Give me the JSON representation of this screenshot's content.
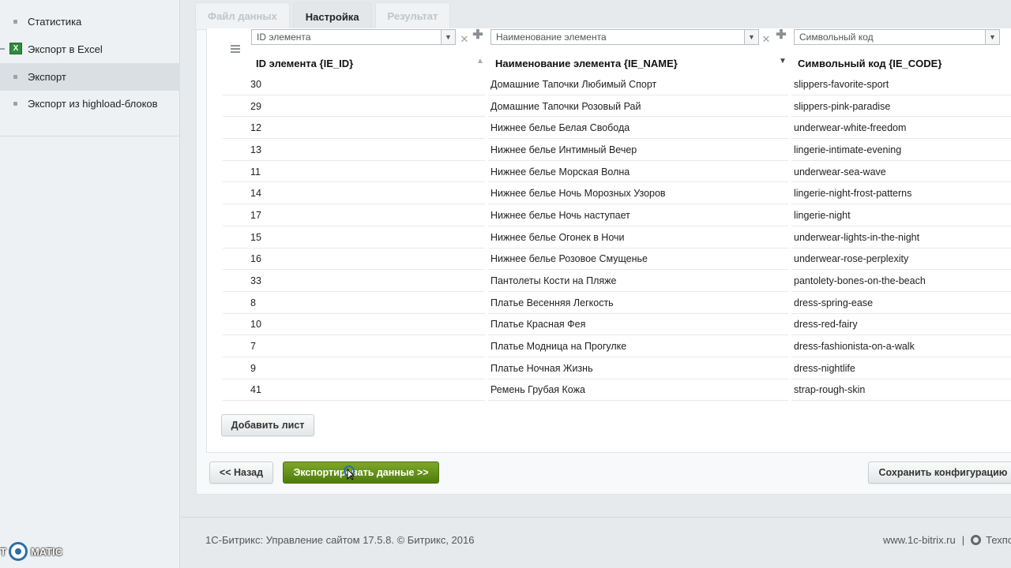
{
  "sidebar": {
    "items": [
      {
        "label": "Статистика",
        "icon": "bullet-icon",
        "active": false
      },
      {
        "label": "Экспорт в Excel",
        "icon": "excel-icon",
        "active": false
      },
      {
        "label": "Экспорт",
        "icon": "bullet-icon",
        "active": true
      },
      {
        "label": "Экспорт из highload-блоков",
        "icon": "bullet-icon",
        "active": false
      }
    ]
  },
  "logo": {
    "left": "T",
    "right": "MATIC"
  },
  "tabs": [
    {
      "label": "Файл данных",
      "active": false
    },
    {
      "label": "Настройка",
      "active": true
    },
    {
      "label": "Результат",
      "active": false
    }
  ],
  "filters": [
    {
      "value": "ID элемента"
    },
    {
      "value": "Наименование элемента"
    },
    {
      "value": "Символьный код"
    }
  ],
  "columns": [
    {
      "label": "ID элемента {IE_ID}",
      "sort": "▲"
    },
    {
      "label": "Наименование элемента {IE_NAME}",
      "sort": "▼"
    },
    {
      "label": "Символьный код {IE_CODE}",
      "sort": ""
    }
  ],
  "rows": [
    {
      "id": "30",
      "name": "Домашние Тапочки Любимый Спорт",
      "code": "slippers-favorite-sport"
    },
    {
      "id": "29",
      "name": "Домашние Тапочки Розовый Рай",
      "code": "slippers-pink-paradise"
    },
    {
      "id": "12",
      "name": "Нижнее белье Белая Свобода",
      "code": "underwear-white-freedom"
    },
    {
      "id": "13",
      "name": "Нижнее белье Интимный Вечер",
      "code": "lingerie-intimate-evening"
    },
    {
      "id": "11",
      "name": "Нижнее белье Морская Волна",
      "code": "underwear-sea-wave"
    },
    {
      "id": "14",
      "name": "Нижнее белье Ночь Морозных Узоров",
      "code": "lingerie-night-frost-patterns"
    },
    {
      "id": "17",
      "name": "Нижнее белье Ночь наступает",
      "code": "lingerie-night"
    },
    {
      "id": "15",
      "name": "Нижнее белье Огонек в Ночи",
      "code": "underwear-lights-in-the-night"
    },
    {
      "id": "16",
      "name": "Нижнее белье Розовое Смущенье",
      "code": "underwear-rose-perplexity"
    },
    {
      "id": "33",
      "name": "Пантолеты Кости на Пляже",
      "code": "pantolety-bones-on-the-beach"
    },
    {
      "id": "8",
      "name": "Платье Весенняя Легкость",
      "code": "dress-spring-ease"
    },
    {
      "id": "10",
      "name": "Платье Красная Фея",
      "code": "dress-red-fairy"
    },
    {
      "id": "7",
      "name": "Платье Модница на Прогулке",
      "code": "dress-fashionista-on-a-walk"
    },
    {
      "id": "9",
      "name": "Платье Ночная Жизнь",
      "code": "dress-nightlife"
    },
    {
      "id": "41",
      "name": "Ремень Грубая Кожа",
      "code": "strap-rough-skin"
    }
  ],
  "buttons": {
    "add_sheet": "Добавить лист",
    "back": "<< Назад",
    "export": "Экспортировать данные >>",
    "save_config": "Сохранить конфигурацию"
  },
  "footer": {
    "copyright": "1С-Битрикс: Управление сайтом 17.5.8. © Битрикс, 2016",
    "site": "www.1c-bitrix.ru",
    "support": "Техподдержка"
  },
  "colors": {
    "accent_green": "#5a8a14",
    "sidebar_bg": "#eef1f3"
  }
}
